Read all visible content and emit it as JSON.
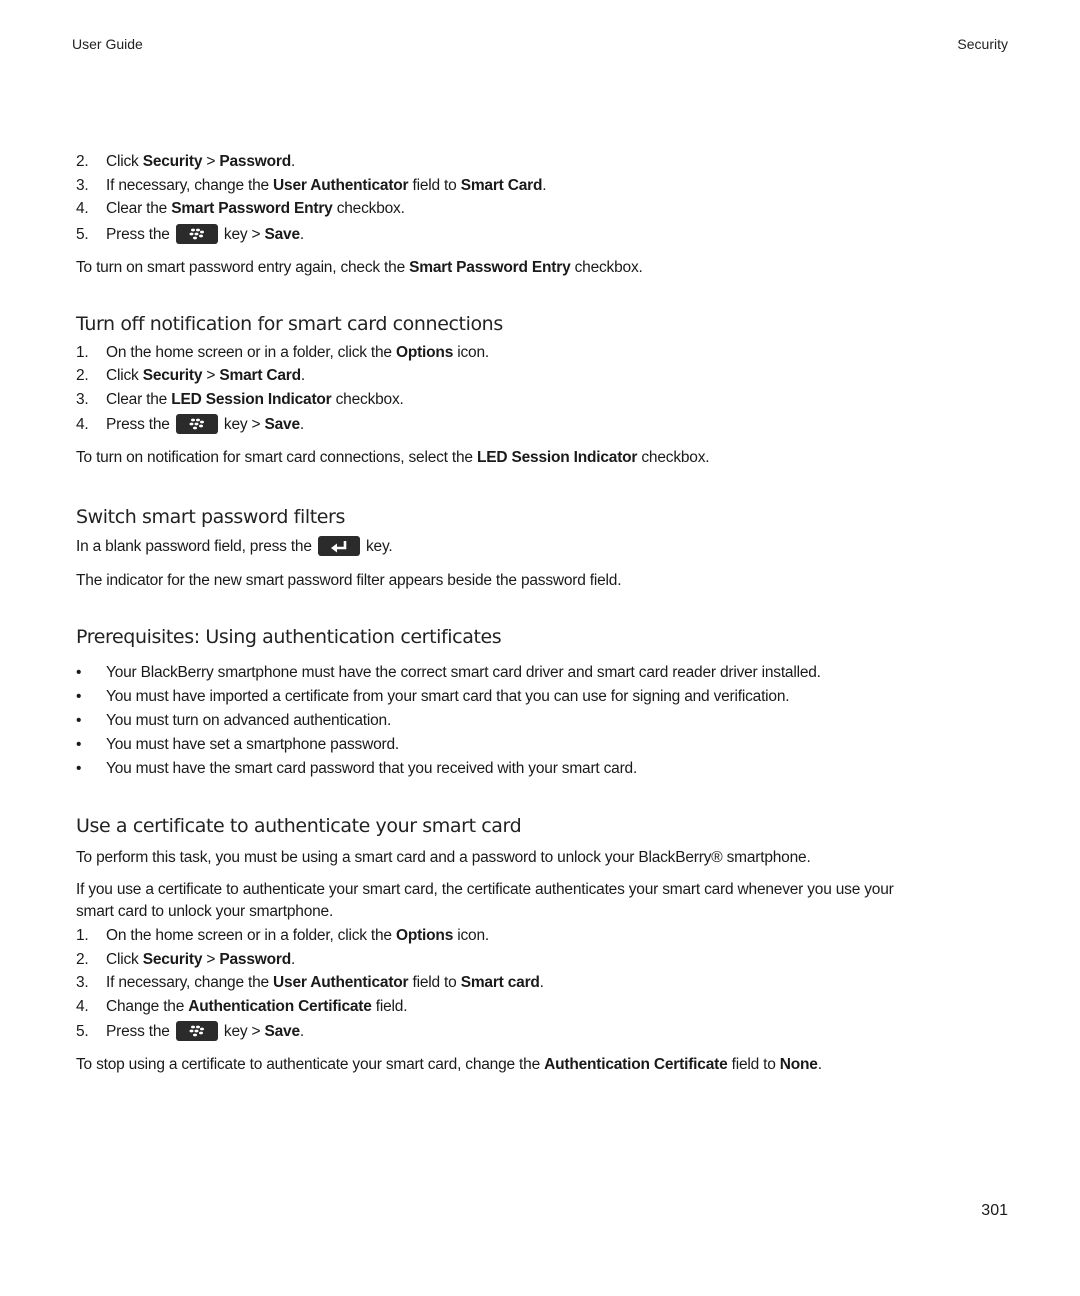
{
  "header": {
    "left": "User Guide",
    "right": "Security"
  },
  "section0": {
    "steps": [
      {
        "num": "2.",
        "parts": [
          "Click ",
          "Security",
          " > ",
          "Password",
          "."
        ]
      },
      {
        "num": "3.",
        "parts": [
          "If necessary, change the ",
          "User Authenticator",
          " field to ",
          "Smart Card",
          "."
        ]
      },
      {
        "num": "4.",
        "parts": [
          "Clear the ",
          "Smart Password Entry",
          " checkbox."
        ]
      },
      {
        "num": "5.",
        "pre": "Press the",
        "key_icon": "blackberry-menu-key-icon",
        "post": " key > ",
        "bold": "Save",
        "end": "."
      }
    ],
    "note": {
      "pre": "To turn on smart password entry again, check the ",
      "bold": "Smart Password Entry",
      "post": " checkbox."
    }
  },
  "section1": {
    "title": "Turn off notification for smart card connections",
    "steps": [
      {
        "num": "1.",
        "parts": [
          "On the home screen or in a folder, click the ",
          "Options",
          " icon."
        ]
      },
      {
        "num": "2.",
        "parts": [
          "Click ",
          "Security",
          " > ",
          "Smart Card",
          "."
        ]
      },
      {
        "num": "3.",
        "parts": [
          "Clear the ",
          "LED Session Indicator",
          " checkbox."
        ]
      },
      {
        "num": "4.",
        "pre": "Press the",
        "key_icon": "blackberry-menu-key-icon",
        "post": " key > ",
        "bold": "Save",
        "end": "."
      }
    ],
    "note": {
      "pre": "To turn on notification for smart card connections, select the ",
      "bold": "LED Session Indicator",
      "post": " checkbox."
    }
  },
  "section2": {
    "title": "Switch smart password filters",
    "para1": {
      "pre": "In a blank password field, press the",
      "key_icon": "enter-key-icon",
      "post": " key."
    },
    "para2": "The indicator for the new smart password filter appears beside the password field."
  },
  "section3": {
    "title": "Prerequisites: Using authentication certificates",
    "bullet_glyph": "•",
    "bullets": [
      "Your BlackBerry smartphone must have the correct smart card driver and smart card reader driver installed.",
      "You must have imported a certificate from your smart card that you can use for signing and verification.",
      "You must turn on advanced authentication.",
      "You must have set a smartphone password.",
      "You must have the smart card password that you received with your smart card."
    ]
  },
  "section4": {
    "title": "Use a certificate to authenticate your smart card",
    "para1": "To perform this task, you must be using a smart card and a password to unlock your BlackBerry® smartphone.",
    "para2_line1": "If you use a certificate to authenticate your smart card, the certificate authenticates your smart card whenever you use your",
    "para2_line2": "smart card to unlock your smartphone.",
    "steps": [
      {
        "num": "1.",
        "parts": [
          "On the home screen or in a folder, click the ",
          "Options",
          " icon."
        ]
      },
      {
        "num": "2.",
        "parts": [
          "Click ",
          "Security",
          " > ",
          "Password",
          "."
        ]
      },
      {
        "num": "3.",
        "parts": [
          "If necessary, change the ",
          "User Authenticator",
          " field to ",
          "Smart card",
          "."
        ]
      },
      {
        "num": "4.",
        "parts": [
          "Change the ",
          "Authentication Certificate",
          " field."
        ]
      },
      {
        "num": "5.",
        "pre": "Press the",
        "key_icon": "blackberry-menu-key-icon",
        "post": " key > ",
        "bold": "Save",
        "end": "."
      }
    ],
    "note": {
      "pre": "To stop using a certificate to authenticate your smart card, change the ",
      "bold": "Authentication Certificate",
      "mid": " field to ",
      "bold2": "None",
      "post": "."
    }
  },
  "page_number": "301"
}
